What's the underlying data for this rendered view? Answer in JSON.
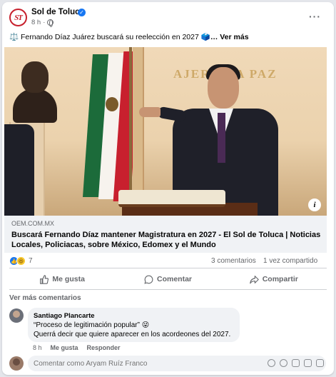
{
  "post": {
    "page_name": "Sol de Toluca",
    "avatar_text": "ST",
    "time": "8 h",
    "caption_icon": "⚖️",
    "caption_text": "Fernando Díaz Juárez buscará su reelección en 2027",
    "caption_emoji": "🗳️",
    "see_more": "… Ver más",
    "image_inscription": "AJERO LA PAZ",
    "info_label": "i"
  },
  "link": {
    "domain": "OEM.COM.MX",
    "title": "Buscará Fernando Díaz mantener Magistratura en 2027 - El Sol de Toluca | Noticias Locales, Policiacas, sobre México, Edomex y el Mundo"
  },
  "stats": {
    "reaction_count": "7",
    "comments": "3 comentarios",
    "shares": "1 vez compartido"
  },
  "actions": {
    "like": "Me gusta",
    "comment": "Comentar",
    "share": "Compartir"
  },
  "comments": {
    "see_more": "Ver más comentarios",
    "items": [
      {
        "author": "Santiago Plancarte",
        "line1": "“Proceso de legitimación popular” 😜",
        "line2": "Querrá decir que quiere aparecer en los acordeones del 2027.",
        "time": "8 h",
        "like": "Me gusta",
        "reply": "Responder"
      }
    ],
    "input_placeholder": "Comentar como Aryam Ruíz Franco"
  },
  "colors": {
    "accent": "#1877f2",
    "brand_red": "#c7202d",
    "muted_text": "#65676b"
  },
  "icons": [
    "verified-icon",
    "globe-icon",
    "more-options-icon",
    "info-icon",
    "like-reaction-icon",
    "haha-reaction-icon",
    "thumbs-up-icon",
    "comment-icon",
    "share-icon",
    "sticker-icon",
    "emoji-icon",
    "camera-icon",
    "gif-icon",
    "avatar-sticker-icon"
  ]
}
